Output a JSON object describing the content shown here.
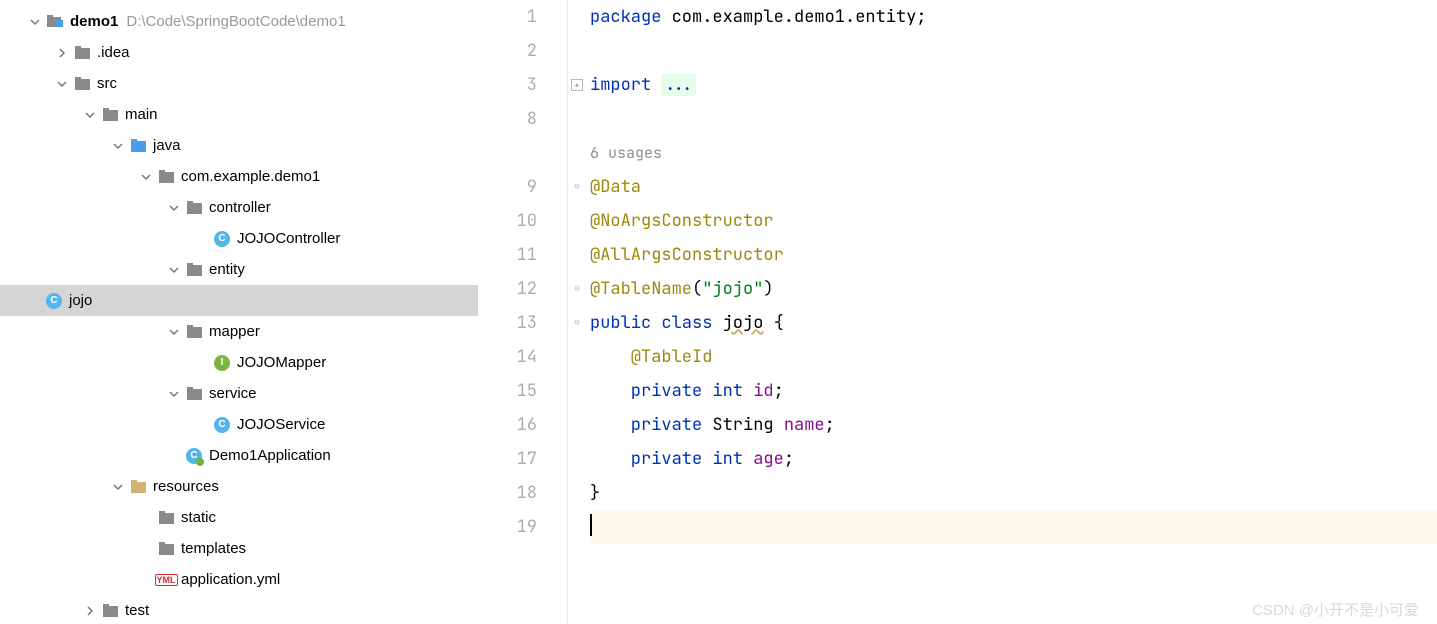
{
  "tree": {
    "root": {
      "name": "demo1",
      "path": "D:\\Code\\SpringBootCode\\demo1"
    },
    "idea": ".idea",
    "src": "src",
    "main": "main",
    "java": "java",
    "pkg": "com.example.demo1",
    "controller_folder": "controller",
    "controller_class": "JOJOController",
    "entity_folder": "entity",
    "entity_class": "jojo",
    "mapper_folder": "mapper",
    "mapper_class": "JOJOMapper",
    "service_folder": "service",
    "service_class": "JOJOService",
    "app_class": "Demo1Application",
    "resources": "resources",
    "static": "static",
    "templates": "templates",
    "app_yml": "application.yml",
    "test": "test"
  },
  "editor": {
    "lines": [
      "1",
      "2",
      "3",
      "8",
      "",
      "9",
      "10",
      "11",
      "12",
      "13",
      "14",
      "15",
      "16",
      "17",
      "18",
      "19"
    ],
    "usages": "6 usages",
    "l1_kw": "package",
    "l1_pkg": " com.example.demo1.entity;",
    "l3_kw": "import",
    "l3_fold": "...",
    "l9": "@Data",
    "l10": "@NoArgsConstructor",
    "l11": "@AllArgsConstructor",
    "l12_anno": "@TableName",
    "l12_paren_open": "(",
    "l12_str": "\"jojo\"",
    "l12_paren_close": ")",
    "l13_public": "public ",
    "l13_class": "class ",
    "l13_name": "jojo",
    "l13_brace": " {",
    "l14": "    @TableId",
    "l15_priv": "    private ",
    "l15_type": "int ",
    "l15_name": "id",
    "l15_semi": ";",
    "l16_priv": "    private ",
    "l16_type": "String ",
    "l16_name": "name",
    "l16_semi": ";",
    "l17_priv": "    private ",
    "l17_type": "int ",
    "l17_name": "age",
    "l17_semi": ";",
    "l18": "}"
  },
  "watermark": "CSDN @小开不是小可爱"
}
